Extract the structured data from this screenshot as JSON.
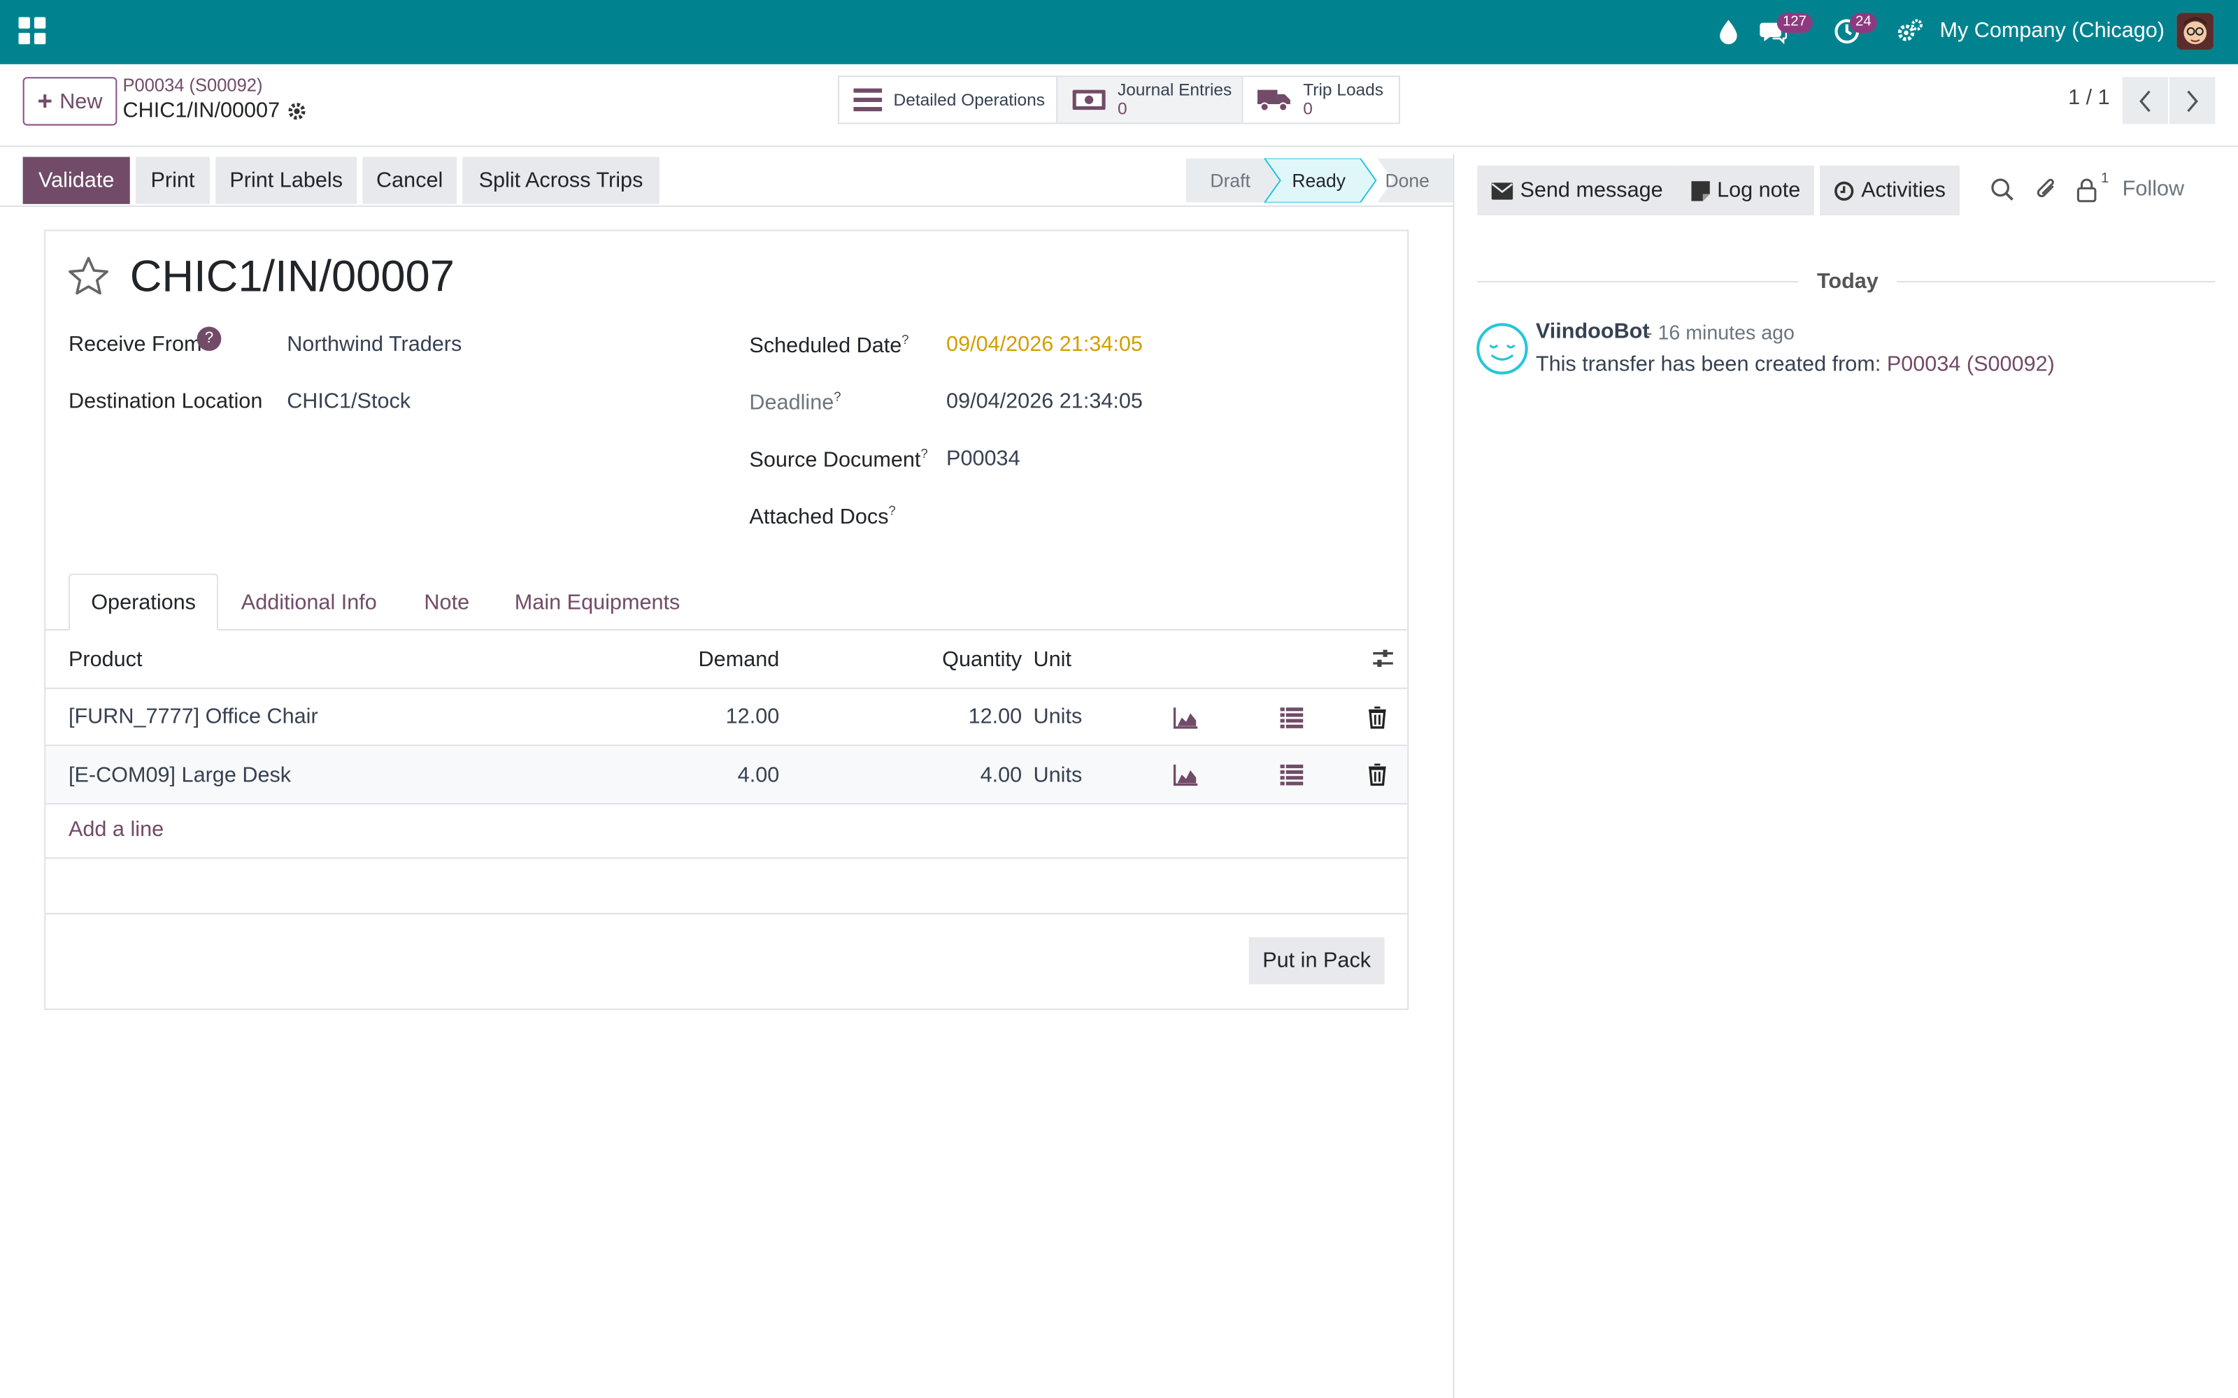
{
  "navbar": {
    "company": "My Company (Chicago)",
    "messages_badge": "127",
    "activities_badge": "24",
    "icons": [
      "apps-icon",
      "water-drop-icon",
      "chat-icon",
      "clock-icon",
      "settings-icon"
    ]
  },
  "control_panel": {
    "new_label": "New",
    "breadcrumb_parent": "P00034 (S00092)",
    "breadcrumb_current": "CHIC1/IN/00007",
    "smart_buttons": {
      "detailed_operations": "Detailed Operations",
      "journal_entries": "Journal Entries",
      "journal_entries_count": "0",
      "trip_loads": "Trip Loads",
      "trip_loads_count": "0"
    },
    "pager": "1 / 1"
  },
  "statusbar": {
    "buttons": [
      "Validate",
      "Print",
      "Print Labels",
      "Cancel",
      "Split Across Trips"
    ],
    "stages": [
      "Draft",
      "Ready",
      "Done"
    ],
    "active_stage": "Ready"
  },
  "form": {
    "title": "CHIC1/IN/00007",
    "receive_from_label": "Receive From",
    "receive_from_help": "?",
    "receive_from": "Northwind Traders",
    "destination_label": "Destination Location",
    "destination": "CHIC1/Stock",
    "scheduled_label": "Scheduled Date",
    "scheduled": "09/04/2026 21:34:05",
    "deadline_label": "Deadline",
    "deadline": "09/04/2026 21:34:05",
    "source_label": "Source Document",
    "source": "P00034",
    "attached_label": "Attached Docs",
    "tooltip_mark": "?",
    "tabs": [
      "Operations",
      "Additional Info",
      "Note",
      "Main Equipments"
    ],
    "active_tab": "Operations",
    "table": {
      "columns": [
        "Product",
        "Demand",
        "Quantity",
        "Unit"
      ],
      "rows": [
        {
          "product": "[FURN_7777] Office Chair",
          "demand": "12.00",
          "quantity": "12.00",
          "unit": "Units"
        },
        {
          "product": "[E-COM09] Large Desk",
          "demand": "4.00",
          "quantity": "4.00",
          "unit": "Units"
        }
      ],
      "add_line": "Add a line"
    },
    "put_in_pack": "Put in Pack"
  },
  "chatter": {
    "send_message": "Send message",
    "log_note": "Log note",
    "activities": "Activities",
    "followers_count": "1",
    "follow": "Follow",
    "date_separator": "Today",
    "message": {
      "author": "ViindooBot",
      "ago": "- 16 minutes ago",
      "text": "This transfer has been created from:",
      "link": "P00034 (S00092)"
    }
  },
  "colors": {
    "navbar": "#00838f",
    "primary": "#714b67",
    "warning_date": "#d39e00",
    "badge": "#8e3a80"
  }
}
